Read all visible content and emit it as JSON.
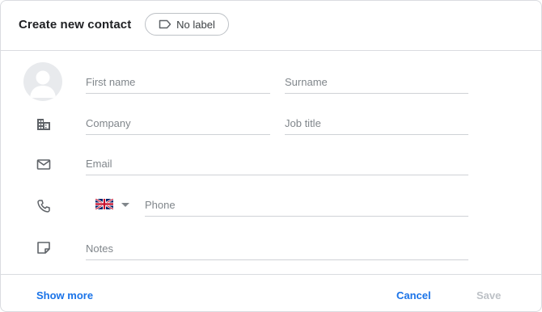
{
  "dialog": {
    "title": "Create new contact",
    "label_chip": "No label"
  },
  "fields": {
    "first_name": "First name",
    "surname": "Surname",
    "company": "Company",
    "job_title": "Job title",
    "email": "Email",
    "phone": "Phone",
    "notes": "Notes"
  },
  "footer": {
    "show_more": "Show more",
    "cancel": "Cancel",
    "save": "Save"
  },
  "icons": {
    "label": "label-outline-icon",
    "avatar": "person-avatar-icon",
    "company": "building-icon",
    "email": "mail-icon",
    "phone": "phone-icon",
    "flag": "uk-flag-icon",
    "notes": "notes-icon"
  },
  "colors": {
    "accent": "#1a73e8",
    "disabled": "#bdc1c6"
  }
}
